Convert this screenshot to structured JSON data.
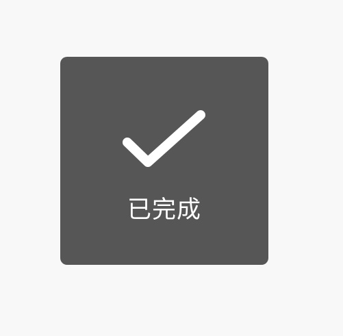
{
  "toast": {
    "icon": "checkmark-icon",
    "message": "已完成",
    "colors": {
      "background": "#565656",
      "foreground": "#ffffff",
      "page": "#f8f8f8"
    }
  }
}
